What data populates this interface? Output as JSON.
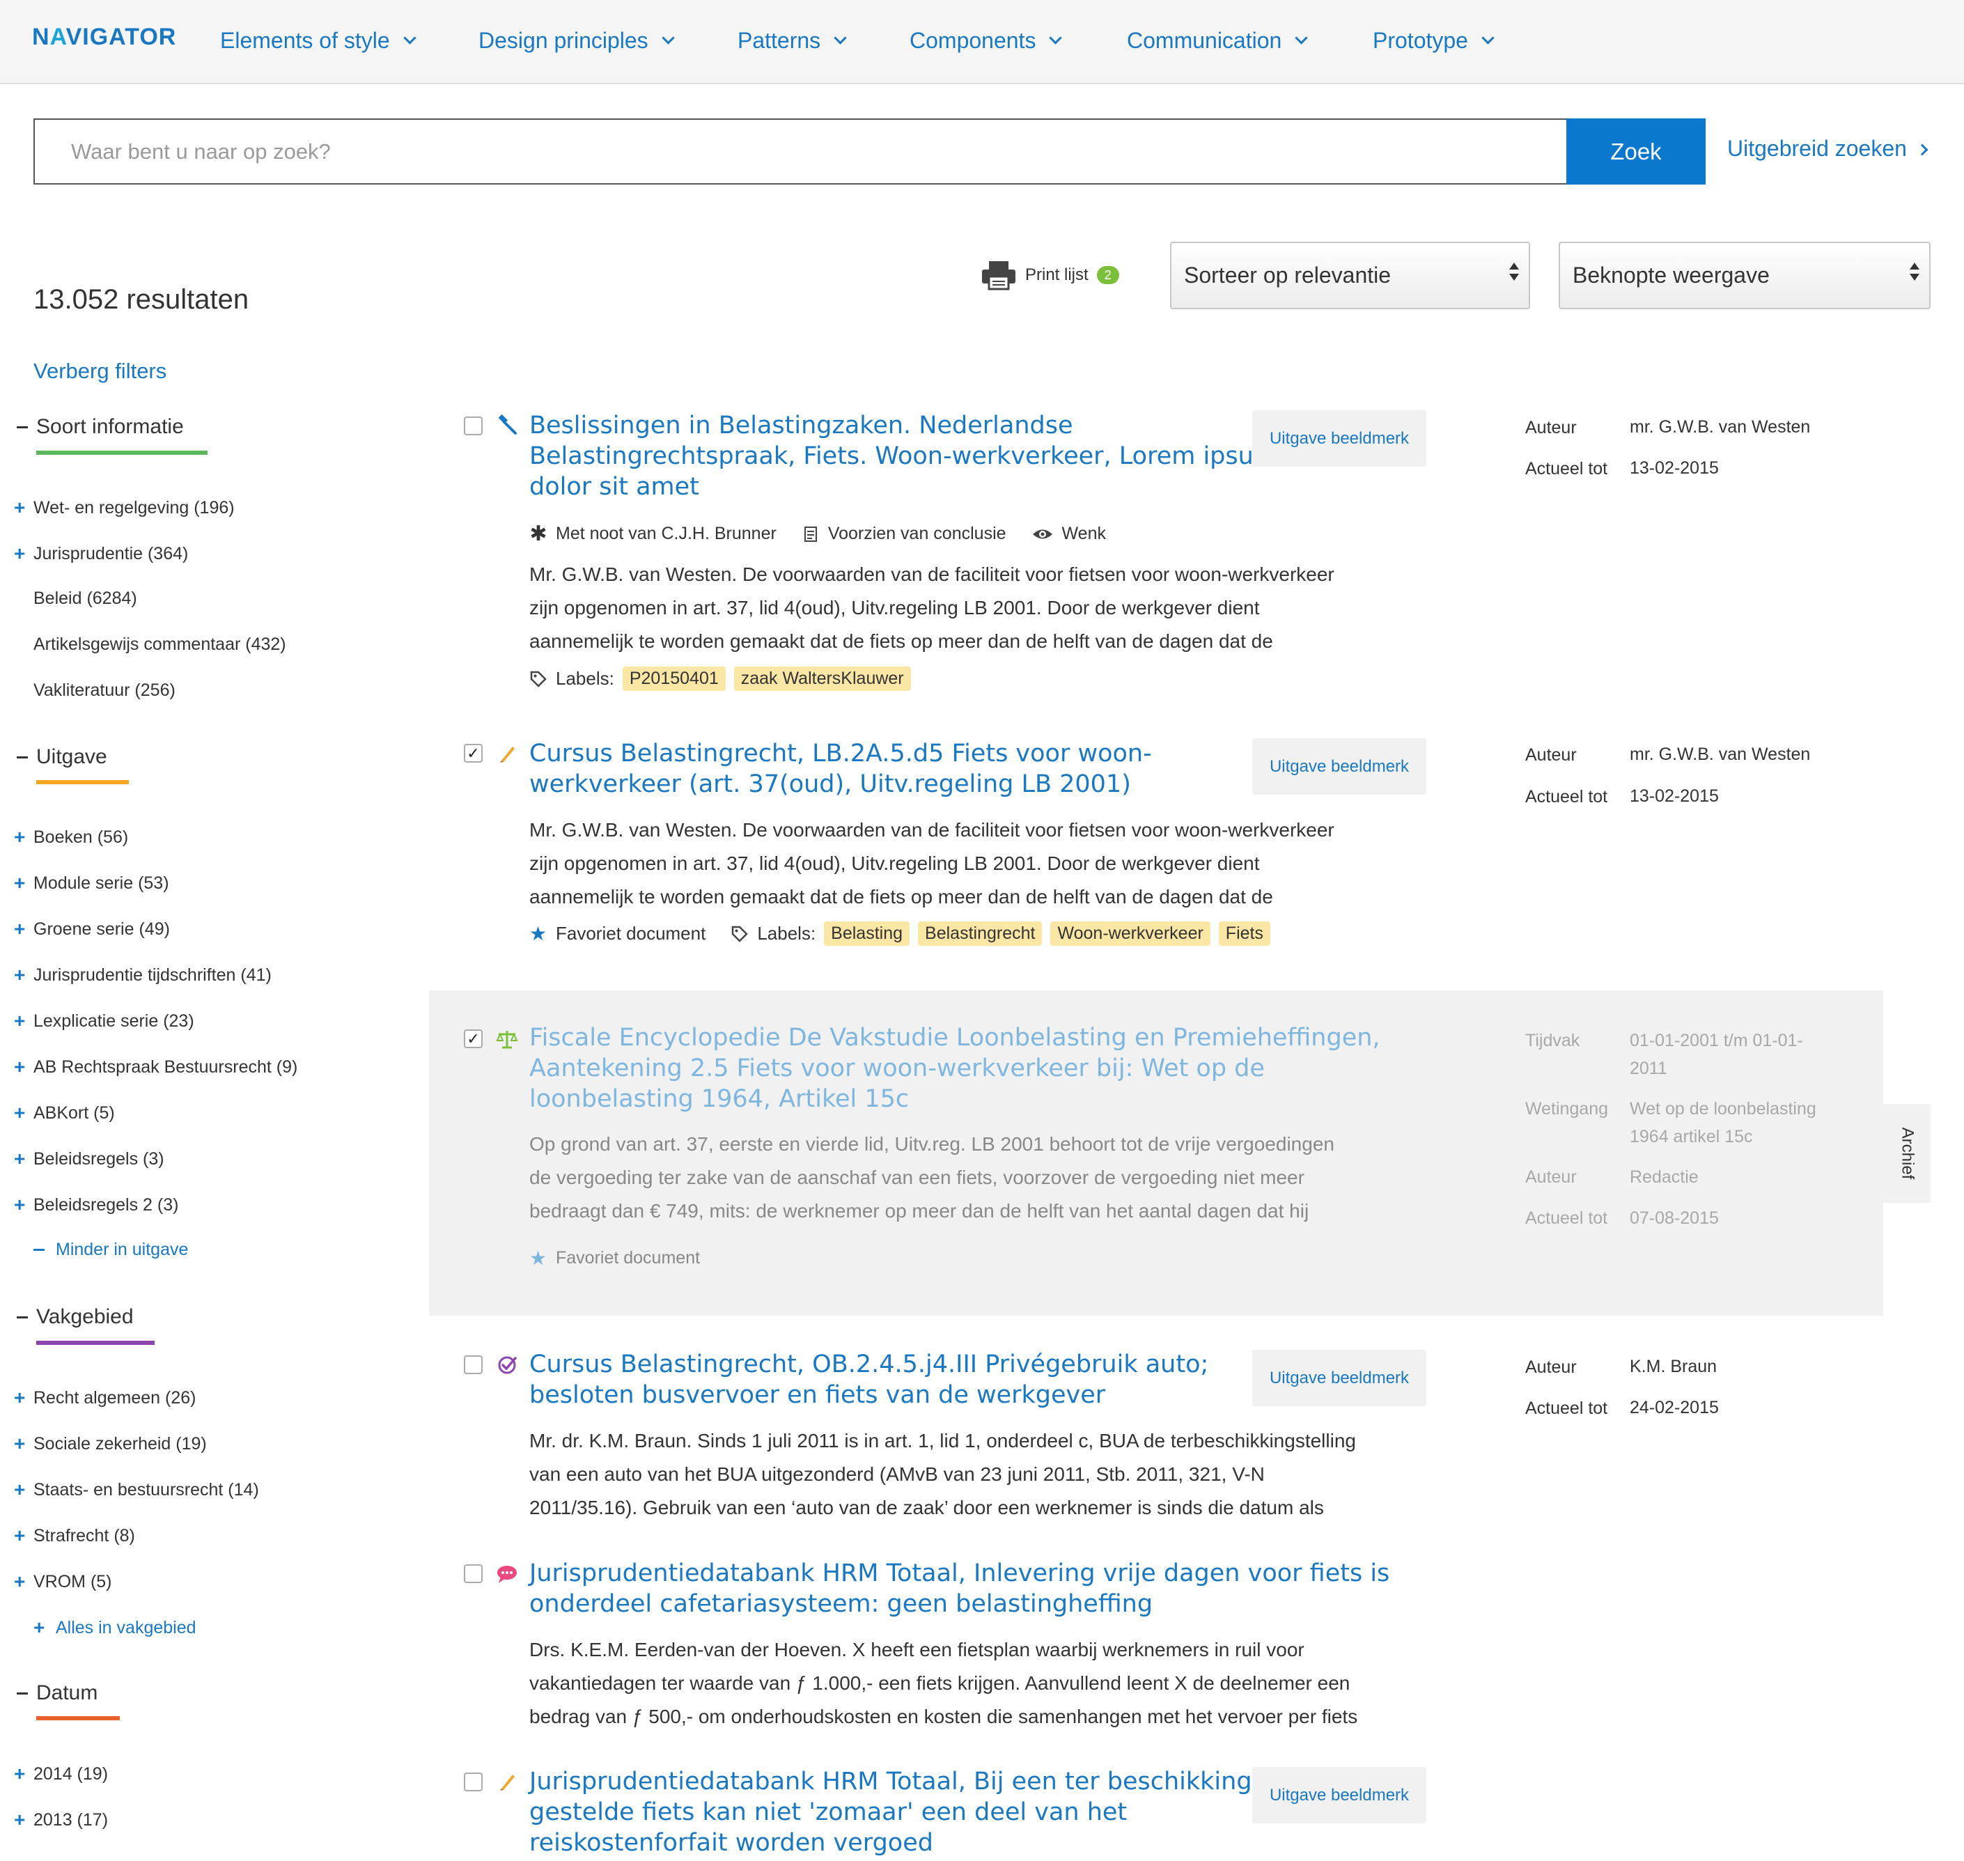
{
  "header": {
    "logo": "NAVIGATOR",
    "nav": [
      "Elements of style",
      "Design principles",
      "Patterns",
      "Components",
      "Communication",
      "Prototype"
    ]
  },
  "search": {
    "placeholder": "Waar bent u naar op zoek?",
    "value": "",
    "button": "Zoek",
    "advanced": "Uitgebreid zoeken"
  },
  "toolbar": {
    "result_count": "13.052 resultaten",
    "print_label": "Print lijst",
    "print_count": "2",
    "sort_select": "Sorteer op relevantie",
    "view_select": "Beknopte weergave"
  },
  "sidebar": {
    "hide_filters": "Verberg filters",
    "groups": [
      {
        "heading": "Soort informatie",
        "color": "#5db65b",
        "items": [
          "Wet- en regelgeving (196)",
          "Jurisprudentie (364)",
          "Beleid (6284)",
          "Artikelsgewijs commentaar (432)",
          "Vakliteratuur (256)"
        ]
      },
      {
        "heading": "Uitgave",
        "color": "#f5a623",
        "items": [
          "Boeken (56)",
          "Module serie (53)",
          "Groene serie (49)",
          "Jurisprudentie tijdschriften (41)",
          "Lexplicatie serie (23)",
          "AB Rechtspraak Bestuursrecht (9)",
          "ABKort (5)",
          "Beleidsregels (3)",
          "Beleidsregels 2 (3)"
        ],
        "more": "Minder in uitgave"
      },
      {
        "heading": "Vakgebied",
        "color": "#8e44ad",
        "items": [
          "Recht algemeen (26)",
          "Sociale zekerheid (19)",
          "Staats- en bestuursrecht (14)",
          "Strafrecht (8)",
          "VROM (5)"
        ],
        "more": "Alles in vakgebied"
      },
      {
        "heading": "Datum",
        "color": "#e8602c",
        "items": [
          "2014 (19)",
          "2013 (17)"
        ]
      }
    ]
  },
  "results": [
    {
      "title_lines": [
        "Beslissingen in Belastingzaken. Nederlandse",
        "Belastingrechtspraak, Fiets. Woon-werkverkeer, Lorem ipsum",
        "dolor sit amet"
      ],
      "checked": false,
      "icon": "gavel-icon",
      "features": [
        "Met noot van C.J.H. Brunner",
        "Voorzien van conclusie",
        "Wenk"
      ],
      "snippet_lines": [
        "Mr. G.W.B. van Westen. De voorwaarden van de faciliteit voor fietsen voor woon-werkverkeer",
        "zijn opgenomen in art. 37, lid 4(oud), Uitv.regeling LB 2001. Door de werkgever dient",
        "aannemelijk te worden gemaakt dat de fiets op meer dan de helft van de dagen dat de"
      ],
      "labels_label": "Labels:",
      "labels": [
        "P20150401",
        "zaak WaltersKlauwer"
      ],
      "edition_button": "Uitgave beeldmerk",
      "meta": [
        {
          "k": "Auteur",
          "v": "mr. G.W.B. van Westen"
        },
        {
          "k": "Actueel tot",
          "v": "13-02-2015"
        }
      ]
    },
    {
      "title_lines": [
        "Cursus Belastingrecht, LB.2A.5.d5 Fiets voor woon-",
        "werkverkeer (art. 37(oud), Uitv.regeling LB 2001)"
      ],
      "checked": true,
      "icon": "pen-icon",
      "snippet_lines": [
        "Mr. G.W.B. van Westen. De voorwaarden van de faciliteit voor fietsen voor woon-werkverkeer",
        "zijn opgenomen in art. 37, lid 4(oud), Uitv.regeling LB 2001. Door de werkgever dient",
        "aannemelijk te worden gemaakt dat de fiets op meer dan de helft van de dagen dat de"
      ],
      "favorite": "Favoriet document",
      "labels_label": "Labels:",
      "labels": [
        "Belasting",
        "Belastingrecht",
        "Woon-werkverkeer",
        "Fiets"
      ],
      "edition_button": "Uitgave beeldmerk",
      "meta": [
        {
          "k": "Auteur",
          "v": "mr. G.W.B. van Westen"
        },
        {
          "k": "Actueel tot",
          "v": "13-02-2015"
        }
      ]
    },
    {
      "title_lines": [
        "Fiscale Encyclopedie De Vakstudie Loonbelasting en Premieheffingen,",
        "Aantekening 2.5 Fiets voor woon-werkverkeer bij: Wet op de",
        "loonbelasting 1964, Artikel 15c"
      ],
      "checked": true,
      "icon": "scales-icon",
      "snippet_lines": [
        "Op grond van art. 37, eerste en vierde lid, Uitv.reg. LB 2001 behoort tot de vrije vergoedingen",
        "de vergoeding ter zake van de aanschaf van een fiets, voorzover de vergoeding niet meer",
        "bedraagt dan € 749, mits: de werknemer op meer dan de helft van het aantal dagen dat hij"
      ],
      "favorite": "Favoriet document",
      "meta": [
        {
          "k": "Tijdvak",
          "v_lines": [
            "01-01-2001 t/m 01-01-",
            "2011"
          ]
        },
        {
          "k": "Wetingang",
          "v_lines": [
            "Wet op de loonbelasting",
            "1964 artikel 15c"
          ]
        },
        {
          "k": "Auteur",
          "v": "Redactie"
        },
        {
          "k": "Actueel tot",
          "v": "07-08-2015"
        }
      ],
      "archive_tab": "Archief"
    },
    {
      "title_lines": [
        "Cursus Belastingrecht, OB.2.4.5.j4.III Privégebruik auto;",
        "besloten busvervoer en fiets van de werkgever"
      ],
      "checked": false,
      "icon": "check-circle-icon",
      "snippet_lines": [
        "Mr. dr. K.M. Braun. Sinds 1 juli 2011 is in art. 1, lid 1, onderdeel c, BUA de terbeschikkingstelling",
        "van een auto van het BUA uitgezonderd (AMvB van 23 juni 2011, Stb. 2011, 321, V-N",
        "2011/35.16). Gebruik van een ‘auto van de zaak’ door een werknemer is sinds die datum als"
      ],
      "edition_button": "Uitgave beeldmerk",
      "meta": [
        {
          "k": "Auteur",
          "v": "K.M. Braun"
        },
        {
          "k": "Actueel tot",
          "v": "24-02-2015"
        }
      ]
    },
    {
      "title_lines": [
        "Jurisprudentiedatabank HRM Totaal, Inlevering vrije dagen voor fiets is",
        "onderdeel cafetariasysteem: geen belastingheffing"
      ],
      "checked": false,
      "icon": "speech-bubble-icon",
      "snippet_lines": [
        "Drs. K.E.M. Eerden-van der Hoeven. X heeft een fietsplan waarbij werknemers in ruil voor",
        "vakantiedagen ter waarde van ƒ 1.000,- een fiets krijgen. Aanvullend leent X de deelnemer een",
        "bedrag van ƒ 500,- om onderhoudskosten en kosten die samenhangen met het vervoer per fiets"
      ]
    },
    {
      "title_lines": [
        "Jurisprudentiedatabank HRM Totaal, Bij een ter beschikking",
        "gestelde fiets kan niet 'zomaar' een deel van het",
        "reiskostenforfait worden vergoed"
      ],
      "checked": false,
      "icon": "pen-icon",
      "edition_button": "Uitgave beeldmerk"
    }
  ],
  "colors": {
    "accent": "#1a78c2",
    "button": "#0a78cc",
    "badge": "#7bbf3b",
    "tag": "#fbe7a5"
  }
}
